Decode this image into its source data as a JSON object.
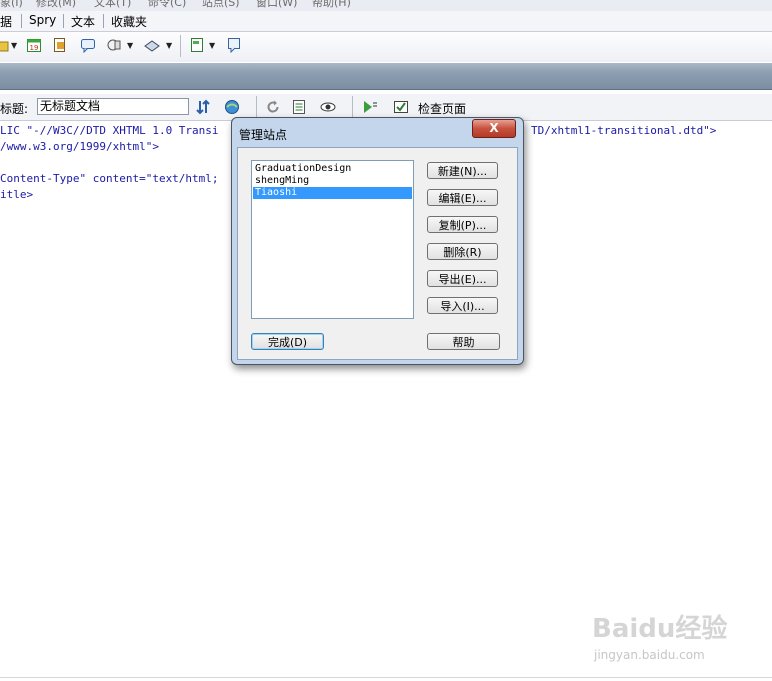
{
  "menu_bar": {
    "items": [
      "象(I)",
      "修改(M)",
      "文本(T)",
      "命令(C)",
      "站点(S)",
      "窗口(W)",
      "帮助(H)"
    ]
  },
  "insert_categories": [
    "据",
    "Spry",
    "文本",
    "收藏夹"
  ],
  "insert_toolbar": {
    "icons": [
      "named-anchor-icon",
      "date-icon",
      "server-side-include-icon",
      "comment-icon",
      "head-icon",
      "script-icon",
      "templates-icon",
      "tag-chooser-icon"
    ]
  },
  "doc_toolbar": {
    "title_label": "标题:",
    "title_value": "无标题文档",
    "check_page_label": "检查页面"
  },
  "code_lines": [
    "LIC \"-//W3C//DTD XHTML 1.0 Transi",
    "TD/xhtml1-transitional.dtd\">",
    "/www.w3.org/1999/xhtml\">",
    "Content-Type\" content=\"text/html;",
    "itle>"
  ],
  "dialog": {
    "title": "管理站点",
    "close_label": "X",
    "sites": [
      "GraduationDesign",
      "shengMing",
      "Tiaoshi"
    ],
    "selected_site": "Tiaoshi",
    "buttons": {
      "new": "新建(N)...",
      "edit": "编辑(E)...",
      "copy": "复制(P)...",
      "delete": "删除(R)",
      "export": "导出(E)...",
      "import": "导入(I)...",
      "done": "完成(D)",
      "help": "帮助"
    }
  },
  "watermark": {
    "brand": "Baidu经验",
    "url": "jingyan.baidu.com"
  },
  "colors": {
    "dialog_frame": "#c3d6ec",
    "selection": "#3399ff",
    "close_button": "#c7523e",
    "code_text": "#1a1aa6"
  }
}
